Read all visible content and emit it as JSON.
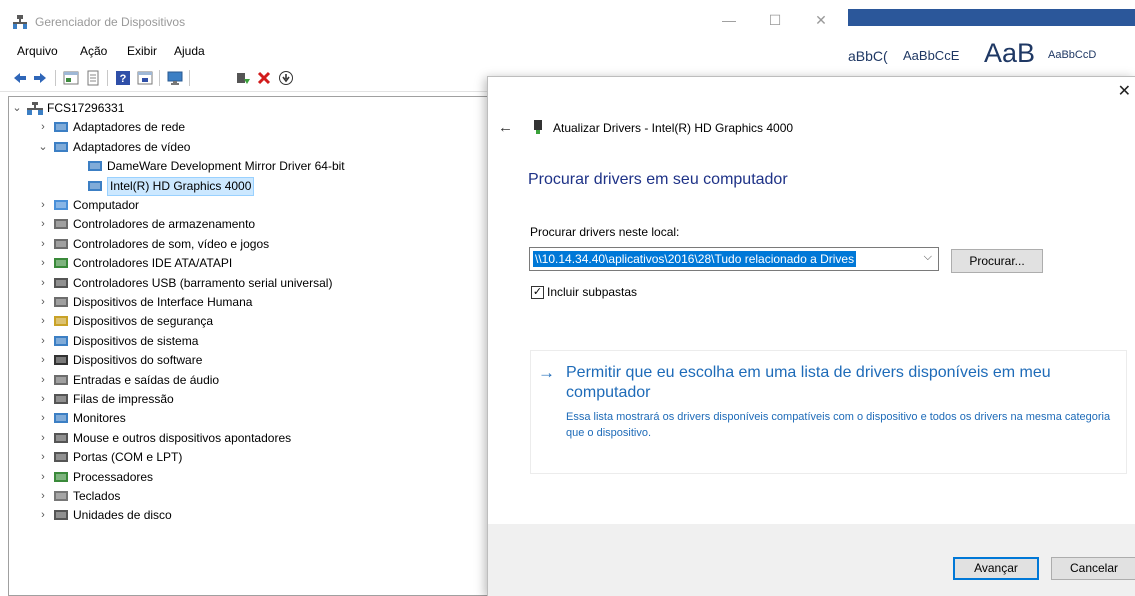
{
  "device_manager": {
    "title": "Gerenciador de Dispositivos",
    "menu": [
      "Arquivo",
      "Ação",
      "Exibir",
      "Ajuda"
    ],
    "window_controls": {
      "minimize": "—",
      "maximize": "☐",
      "close": "✕"
    },
    "tree": {
      "root": "FCS17296331",
      "nodes": [
        {
          "label": "Adaptadores de rede",
          "icon": "network-adapter-icon",
          "expanded": false
        },
        {
          "label": "Adaptadores de vídeo",
          "icon": "display-adapter-icon",
          "expanded": true,
          "children": [
            {
              "label": "DameWare Development Mirror Driver 64-bit",
              "icon": "display-adapter-icon"
            },
            {
              "label": "Intel(R) HD Graphics 4000",
              "icon": "display-adapter-icon",
              "selected": true
            }
          ]
        },
        {
          "label": "Computador",
          "icon": "computer-icon",
          "expanded": false
        },
        {
          "label": "Controladores de armazenamento",
          "icon": "storage-controller-icon",
          "expanded": false
        },
        {
          "label": "Controladores de som, vídeo e jogos",
          "icon": "speaker-icon",
          "expanded": false
        },
        {
          "label": "Controladores IDE ATA/ATAPI",
          "icon": "ide-controller-icon",
          "expanded": false
        },
        {
          "label": "Controladores USB (barramento serial universal)",
          "icon": "usb-icon",
          "expanded": false
        },
        {
          "label": "Dispositivos de Interface Humana",
          "icon": "hid-icon",
          "expanded": false
        },
        {
          "label": "Dispositivos de segurança",
          "icon": "security-device-icon",
          "expanded": false
        },
        {
          "label": "Dispositivos de sistema",
          "icon": "system-device-icon",
          "expanded": false
        },
        {
          "label": "Dispositivos do software",
          "icon": "software-device-icon",
          "expanded": false
        },
        {
          "label": "Entradas e saídas de áudio",
          "icon": "audio-io-icon",
          "expanded": false
        },
        {
          "label": "Filas de impressão",
          "icon": "printer-icon",
          "expanded": false
        },
        {
          "label": "Monitores",
          "icon": "monitor-icon",
          "expanded": false
        },
        {
          "label": "Mouse e outros dispositivos apontadores",
          "icon": "mouse-icon",
          "expanded": false
        },
        {
          "label": "Portas (COM e LPT)",
          "icon": "port-icon",
          "expanded": false
        },
        {
          "label": "Processadores",
          "icon": "processor-icon",
          "expanded": false
        },
        {
          "label": "Teclados",
          "icon": "keyboard-icon",
          "expanded": false
        },
        {
          "label": "Unidades de disco",
          "icon": "disk-drive-icon",
          "expanded": false
        }
      ]
    }
  },
  "word_background": {
    "styles": [
      "aBbC(",
      "AaBbCcE",
      "AaB",
      "AaBbCcD"
    ]
  },
  "dialog": {
    "close": "✕",
    "back": "←",
    "header_title": "Atualizar Drivers - Intel(R) HD Graphics 4000",
    "heading": "Procurar drivers em seu computador",
    "path_label": "Procurar drivers neste local:",
    "path_value": "\\\\10.14.34.40\\aplicativos\\2016\\28\\Tudo relacionado a Drives",
    "browse_label": "Procurar...",
    "include_subfolders_label": "Incluir subpastas",
    "include_subfolders_checked": true,
    "choice_arrow": "→",
    "choice_title": "Permitir que eu escolha em uma lista de drivers disponíveis em meu computador",
    "choice_description": "Essa lista mostrará os drivers disponíveis compatíveis com o dispositivo e todos os drivers na mesma categoria que o dispositivo.",
    "next_label": "Avançar",
    "cancel_label": "Cancelar"
  },
  "colors": {
    "accent_blue": "#0078d7",
    "heading_blue": "#1e3287",
    "link_blue": "#1e6bb8",
    "word_ribbon": "#2b579a",
    "selection": "#cce8ff"
  }
}
